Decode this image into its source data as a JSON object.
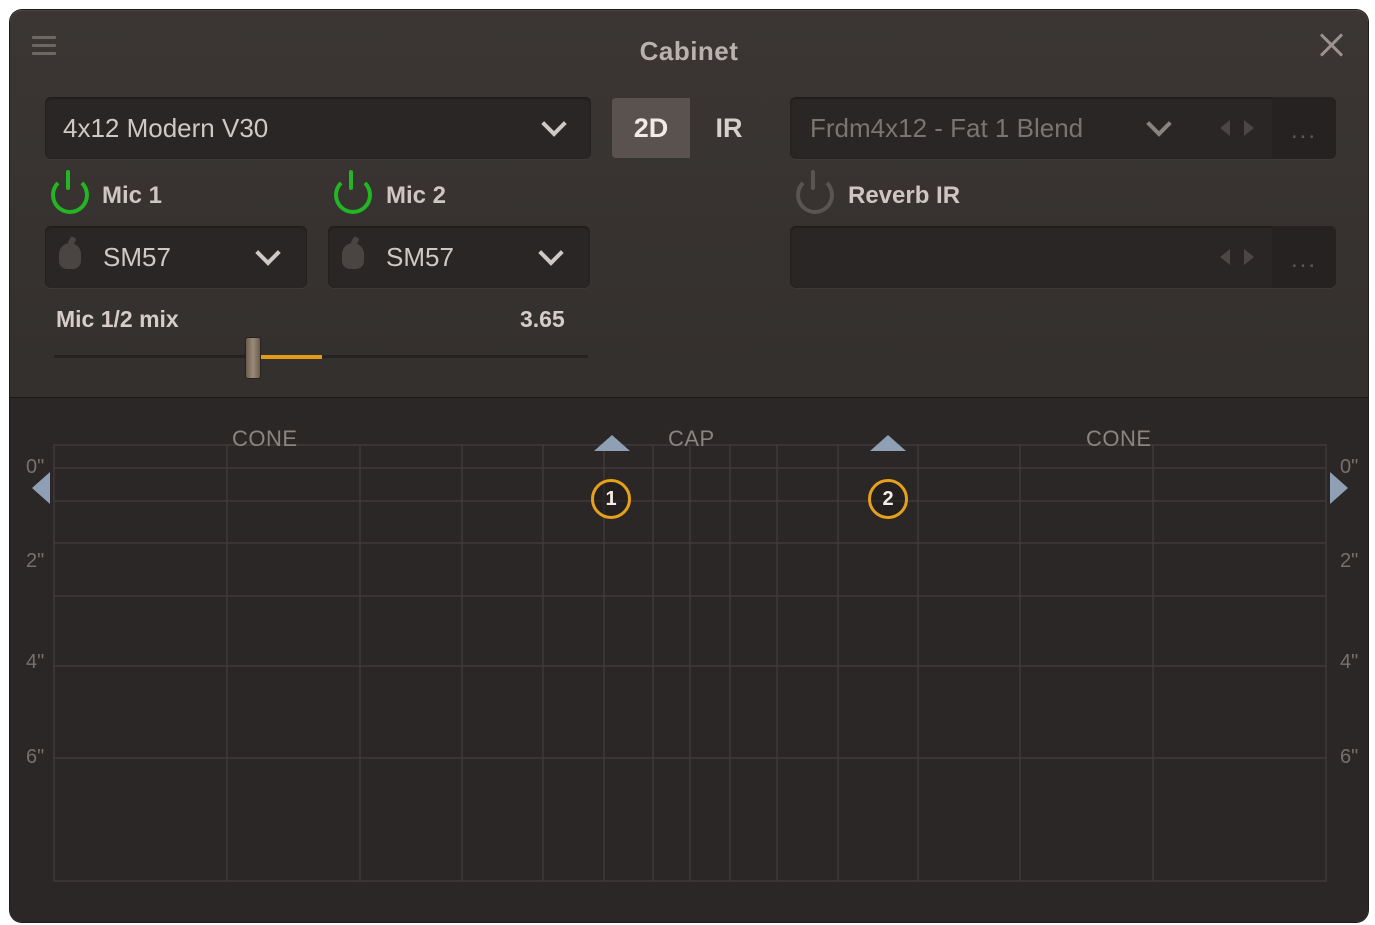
{
  "window": {
    "title": "Cabinet"
  },
  "cabinet": {
    "selected": "4x12 Modern V30"
  },
  "mode_toggle": {
    "options": [
      "2D",
      "IR"
    ],
    "selected": "2D"
  },
  "ir_loader": {
    "selected": "Frdm4x12 - Fat 1 Blend",
    "more_label": "..."
  },
  "mic1": {
    "label": "Mic 1",
    "enabled": true,
    "model": "SM57"
  },
  "mic2": {
    "label": "Mic 2",
    "enabled": true,
    "model": "SM57"
  },
  "reverb_ir": {
    "label": "Reverb IR",
    "enabled": false,
    "selected": "",
    "more_label": "..."
  },
  "mix": {
    "label": "Mic 1/2 mix",
    "value": "3.65",
    "position_fraction": 0.37
  },
  "placement": {
    "zone_labels": [
      "CONE",
      "CAP",
      "CONE"
    ],
    "depth_labels": [
      "0\"",
      "2\"",
      "4\"",
      "6\""
    ],
    "markers": [
      {
        "label": "1"
      },
      {
        "label": "2"
      }
    ]
  },
  "colors": {
    "accent": "#e5a11b",
    "power_on": "#23b523",
    "power_off": "#5a5452",
    "marker_arrow": "#8f9fb4",
    "background": "#34302e"
  },
  "icons": [
    "menu-icon",
    "close-icon",
    "chevron-down-icon",
    "power-icon",
    "microphone-icon",
    "arrow-left-icon",
    "arrow-right-icon"
  ]
}
